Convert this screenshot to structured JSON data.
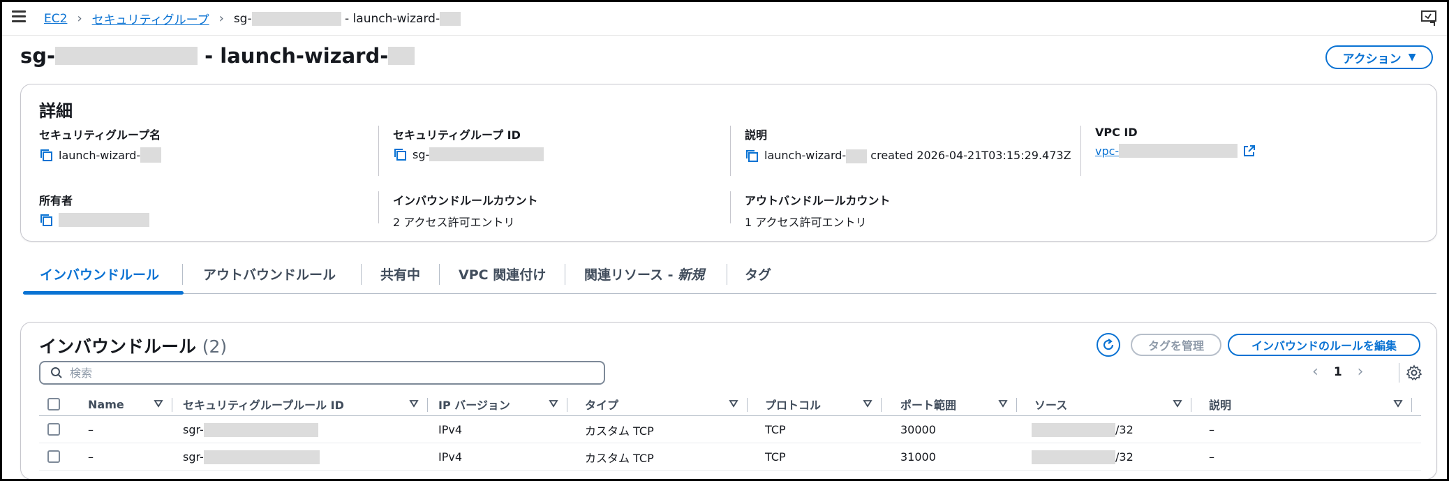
{
  "breadcrumb": {
    "home": "EC2",
    "parent": "セキュリティグループ",
    "current_prefix": "sg-",
    "current_mid": " - launch-wizard-"
  },
  "title": {
    "prefix": "sg-",
    "mid": " - launch-wizard-"
  },
  "actions_label": "アクション",
  "details": {
    "heading": "詳細",
    "sg_name_label": "セキュリティグループ名",
    "sg_name_value": "launch-wizard-",
    "sg_id_label": "セキュリティグループ ID",
    "sg_id_value": "sg-",
    "desc_label": "説明",
    "desc_value_prefix": "launch-wizard-",
    "desc_value_suffix": " created 2026-04-21T03:15:29.473Z",
    "vpc_label": "VPC ID",
    "vpc_value": "vpc-",
    "owner_label": "所有者",
    "inbound_count_label": "インバウンドルールカウント",
    "inbound_count_value": "2 アクセス許可エントリ",
    "outbound_count_label": "アウトバンドルールカウント",
    "outbound_count_value": "1 アクセス許可エントリ"
  },
  "tabs": [
    {
      "label": "インバウンドルール"
    },
    {
      "label": "アウトバウンドルール"
    },
    {
      "label": "共有中"
    },
    {
      "label": "VPC 関連付け"
    },
    {
      "label": "関連リソース - ",
      "italic": "新規"
    },
    {
      "label": "タグ"
    }
  ],
  "rules": {
    "title": "インバウンドルール",
    "count": "(2)",
    "manage_tags": "タグを管理",
    "edit_rules": "インバウンドのルールを編集",
    "search_placeholder": "検索",
    "page": "1",
    "columns": [
      "Name",
      "セキュリティグループルール ID",
      "IP バージョン",
      "タイプ",
      "プロトコル",
      "ポート範囲",
      "ソース",
      "説明"
    ],
    "rows": [
      {
        "name": "–",
        "rule_id_prefix": "sgr-",
        "ip_version": "IPv4",
        "type": "カスタム TCP",
        "protocol": "TCP",
        "port": "30000",
        "source_suffix": "/32",
        "description": "–"
      },
      {
        "name": "–",
        "rule_id_prefix": "sgr-",
        "ip_version": "IPv4",
        "type": "カスタム TCP",
        "protocol": "TCP",
        "port": "31000",
        "source_suffix": "/32",
        "description": "–"
      }
    ]
  },
  "colors": {
    "accent": "#0972d3",
    "border": "#c6c6cd",
    "text": "#16191f",
    "muted": "#5f6b7a"
  }
}
